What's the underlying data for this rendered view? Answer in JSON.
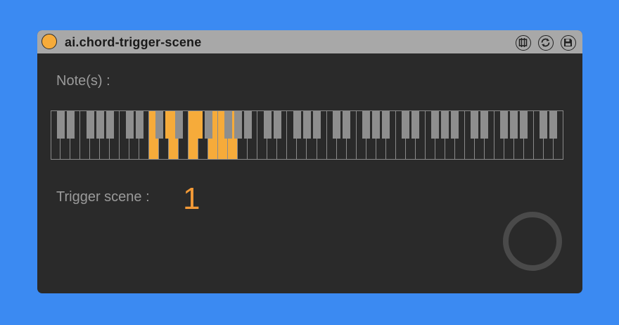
{
  "device": {
    "title": "ai.chord-trigger-scene",
    "power_state": "on",
    "icons": [
      "freeze-icon",
      "refresh-icon",
      "save-icon"
    ]
  },
  "notes": {
    "label": "Note(s) :",
    "selected_midi_notes": [
      41,
      44,
      45,
      48,
      49,
      52,
      53,
      55
    ],
    "first_midi_note": 24,
    "active_color": "#f6ab3a",
    "black_key_color": "#8e8e8e"
  },
  "trigger": {
    "label": "Trigger scene :",
    "value": "1",
    "value_color": "#f39a37"
  },
  "colors": {
    "background": "#3b8af2",
    "panel": "#2a2a2a",
    "titlebar": "#a8a8a8"
  }
}
